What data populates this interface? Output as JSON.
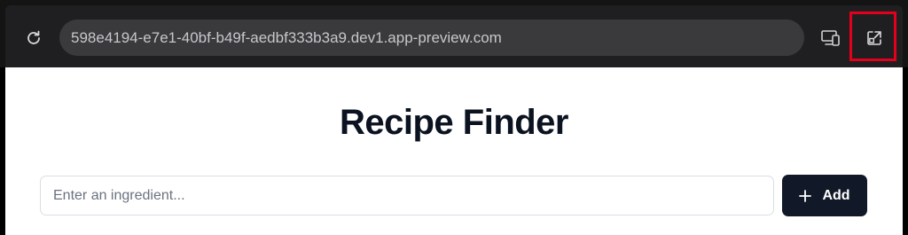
{
  "browser": {
    "url": "598e4194-e7e1-40bf-b49f-aedbf333b3a9.dev1.app-preview.com",
    "icons": {
      "reload": "reload-icon",
      "device_preview": "devices-icon",
      "open_external": "open-in-new-window-icon"
    },
    "highlight_color": "#e4001b"
  },
  "app": {
    "title": "Recipe Finder",
    "ingredient_input": {
      "placeholder": "Enter an ingredient...",
      "value": ""
    },
    "add_button_label": "Add",
    "accent_color": "#111827"
  }
}
